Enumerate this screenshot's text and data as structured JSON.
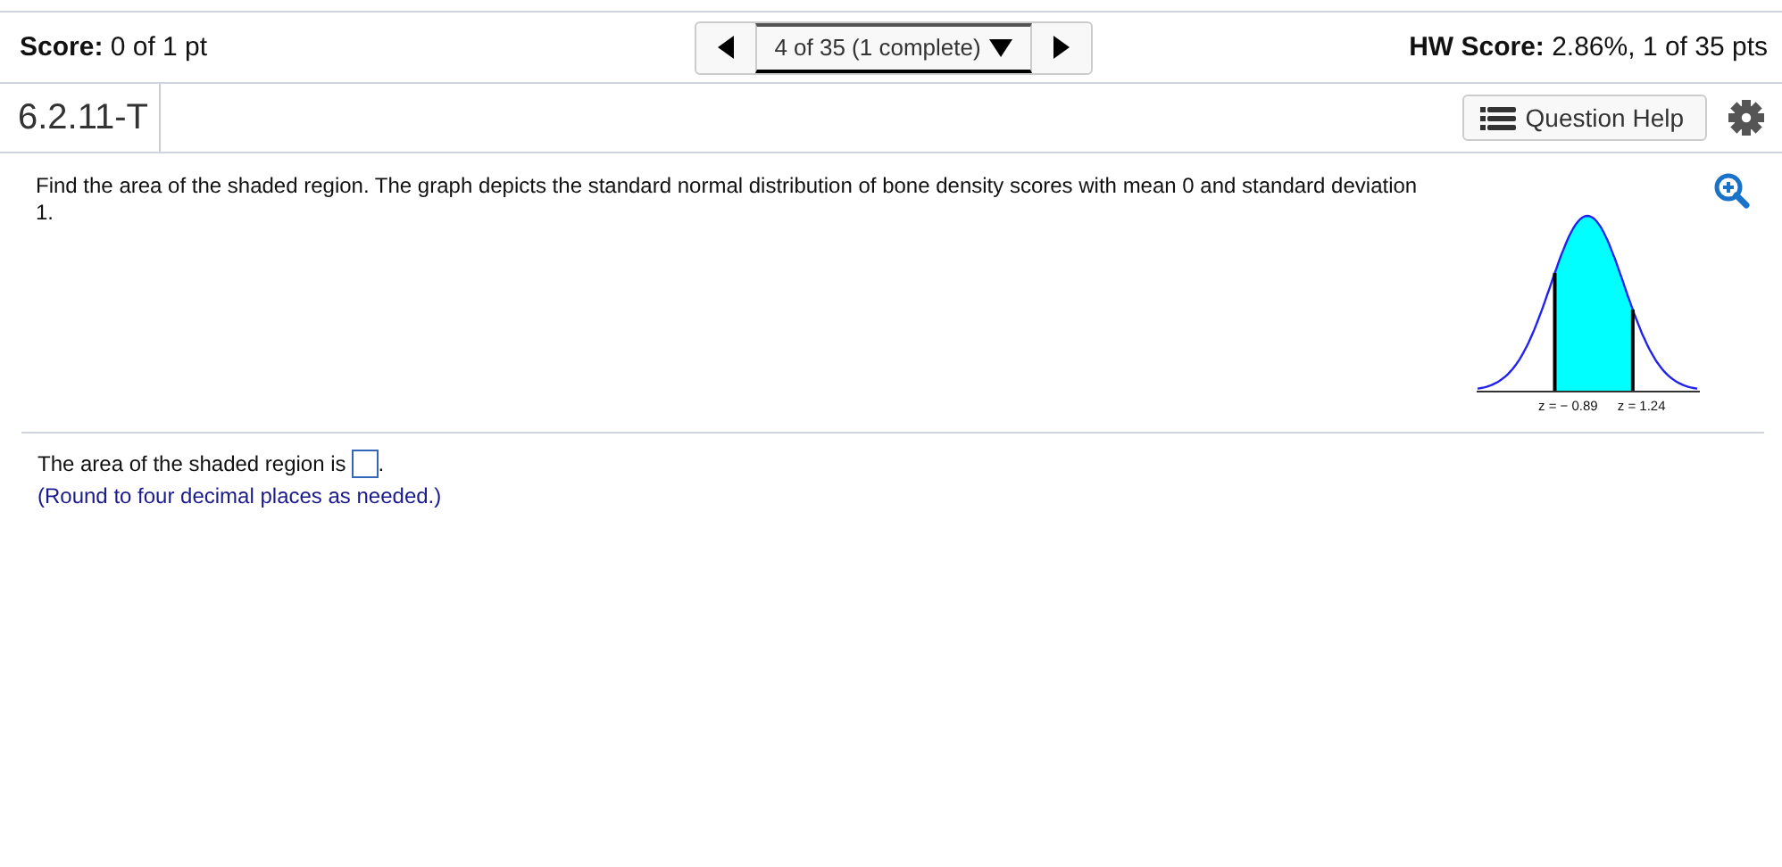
{
  "header": {
    "score_label": "Score:",
    "score_value": "0 of 1 pt",
    "nav_position": "4 of 35 (1 complete)",
    "hw_score_label": "HW Score:",
    "hw_score_value": "2.86%, 1 of 35 pts"
  },
  "question_bar": {
    "question_id": "6.2.11-T",
    "help_button": "Question Help"
  },
  "question": {
    "text": "Find the area of the shaded region. The graph depicts the standard normal distribution of bone density scores with mean 0 and standard deviation 1.",
    "figure": {
      "left_label": "z = − 0.89",
      "right_label": "z = 1.24"
    }
  },
  "answer": {
    "prompt": "The area of the shaded region is",
    "suffix": ".",
    "hint": "(Round to four decimal places as needed.)"
  }
}
